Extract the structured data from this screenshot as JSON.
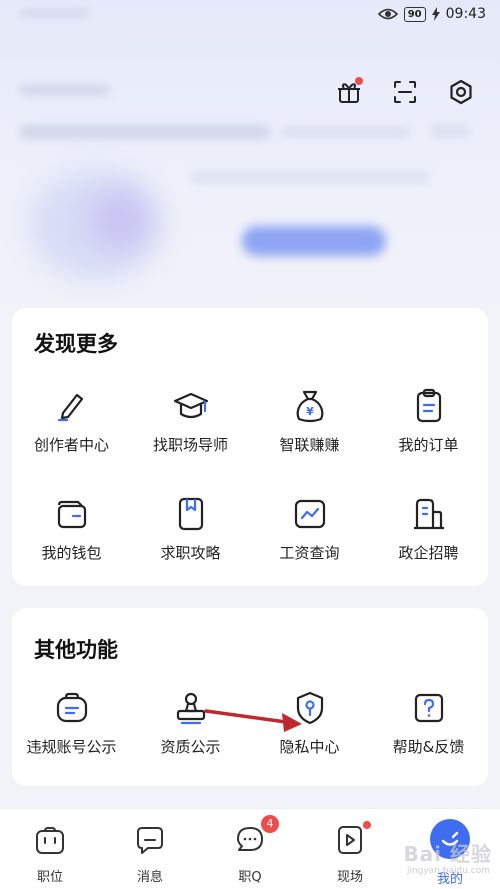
{
  "status_bar": {
    "battery": "90",
    "time": "09:43"
  },
  "top_icons": [
    "gift-icon",
    "scan-icon",
    "settings-icon"
  ],
  "discover": {
    "title": "发现更多",
    "items": [
      {
        "label": "创作者中心",
        "icon": "pencil-icon"
      },
      {
        "label": "找职场导师",
        "icon": "graduation-cap-icon"
      },
      {
        "label": "智联赚赚",
        "icon": "money-bag-icon"
      },
      {
        "label": "我的订单",
        "icon": "clipboard-icon"
      },
      {
        "label": "我的钱包",
        "icon": "wallet-icon"
      },
      {
        "label": "求职攻略",
        "icon": "bookmark-book-icon"
      },
      {
        "label": "工资查询",
        "icon": "chart-line-icon"
      },
      {
        "label": "政企招聘",
        "icon": "building-icon"
      }
    ]
  },
  "other": {
    "title": "其他功能",
    "items": [
      {
        "label": "违规账号公示",
        "icon": "notice-icon"
      },
      {
        "label": "资质公示",
        "icon": "stamp-icon"
      },
      {
        "label": "隐私中心",
        "icon": "privacy-shield-icon"
      },
      {
        "label": "帮助&反馈",
        "icon": "help-icon"
      }
    ]
  },
  "bottom_nav": [
    {
      "label": "职位",
      "icon": "briefcase-icon"
    },
    {
      "label": "消息",
      "icon": "message-icon"
    },
    {
      "label": "职Q",
      "icon": "chat-q-icon",
      "badge": "4"
    },
    {
      "label": "现场",
      "icon": "video-play-icon",
      "dot": true
    },
    {
      "label": "我的",
      "icon": "profile-icon",
      "active": true
    }
  ],
  "watermark": {
    "text": "Bai 经验",
    "sub": "jingyan.baidu.com"
  },
  "colors": {
    "accent": "#3f6df0",
    "badge": "#f04b4b",
    "arrow": "#c0282d"
  }
}
